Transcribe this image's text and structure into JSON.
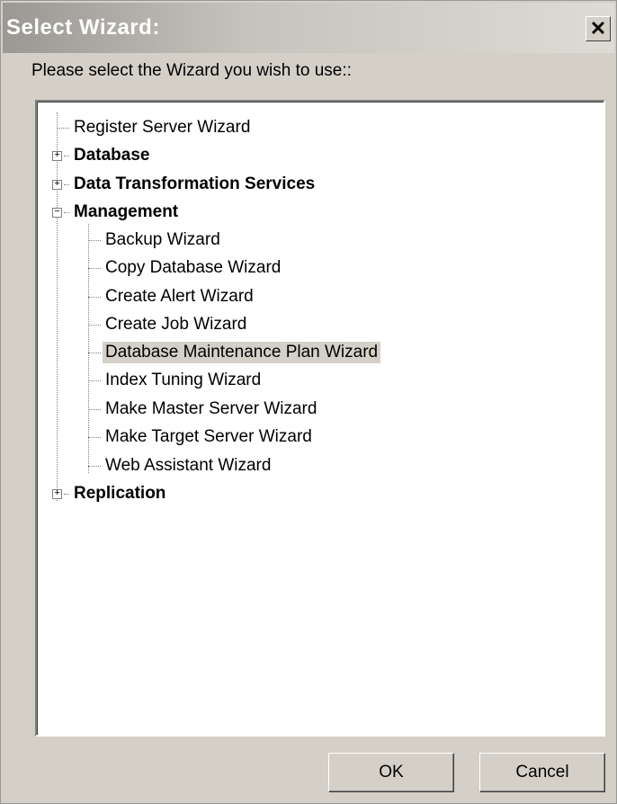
{
  "window": {
    "title": "Select Wizard:",
    "close_symbol": "✕"
  },
  "prompt": "Please select the Wizard you wish to use::",
  "tree": {
    "register": "Register Server Wizard",
    "database": "Database",
    "dts": "Data Transformation Services",
    "management": "Management",
    "management_items": [
      "Backup Wizard",
      "Copy Database Wizard",
      "Create Alert Wizard",
      "Create Job Wizard",
      "Database Maintenance Plan Wizard",
      "Index Tuning Wizard",
      "Make Master Server Wizard",
      "Make Target Server Wizard",
      "Web Assistant Wizard"
    ],
    "replication": "Replication",
    "expand_symbol": "+",
    "collapse_symbol": "−"
  },
  "buttons": {
    "ok": "OK",
    "cancel": "Cancel"
  }
}
